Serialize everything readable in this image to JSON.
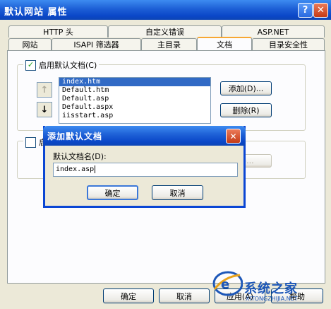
{
  "window": {
    "title": "默认网站 属性",
    "help_glyph": "?",
    "close_glyph": "✕"
  },
  "tabs_row1": [
    "HTTP 头",
    "自定义错误",
    "ASP.NET"
  ],
  "tabs_row2": [
    "网站",
    "ISAPI 筛选器",
    "主目录",
    "文档",
    "目录安全性"
  ],
  "active_tab": "文档",
  "default_docs": {
    "enable_label": "启用默认文档(C)",
    "enabled": true,
    "up_glyph": "↑",
    "down_glyph": "↓",
    "items": [
      "index.htm",
      "Default.htm",
      "Default.asp",
      "Default.aspx",
      "iisstart.asp"
    ],
    "selected_index": 0,
    "add_label": "添加(D)...",
    "remove_label": "删除(R)"
  },
  "footer_section": {
    "partial_label": "启",
    "partial_button": "B)..."
  },
  "dialog": {
    "title": "添加默认文档",
    "close_glyph": "✕",
    "field_label": "默认文档名(D):",
    "field_value": "index.asp",
    "ok_label": "确定",
    "cancel_label": "取消"
  },
  "bottom_buttons": {
    "ok": "确定",
    "cancel": "取消",
    "apply": "应用(A)",
    "help": "帮助"
  },
  "watermark": {
    "brand": "系统之家",
    "url": "XITONGZHIJIA.NET"
  },
  "colors": {
    "title_blue": "#0a47c8",
    "selection": "#316ac5",
    "tab_highlight": "#f7a733",
    "close_red": "#c43a16"
  }
}
